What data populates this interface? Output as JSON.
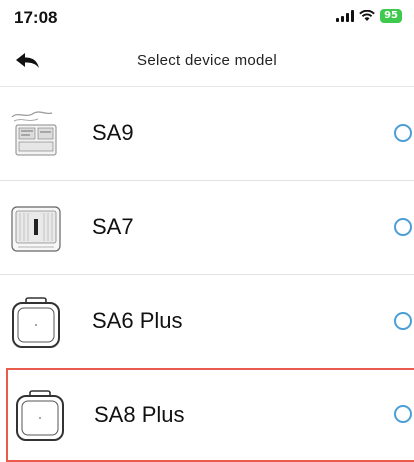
{
  "status": {
    "time": "17:08",
    "battery": "95"
  },
  "nav": {
    "title": "Select device model"
  },
  "devices": [
    {
      "label": "SA9"
    },
    {
      "label": "SA7"
    },
    {
      "label": "SA6 Plus"
    },
    {
      "label": "SA8 Plus"
    }
  ],
  "colors": {
    "radio": "#4a9fd8",
    "highlight": "#e85b4d",
    "battery": "#3fc94e"
  }
}
